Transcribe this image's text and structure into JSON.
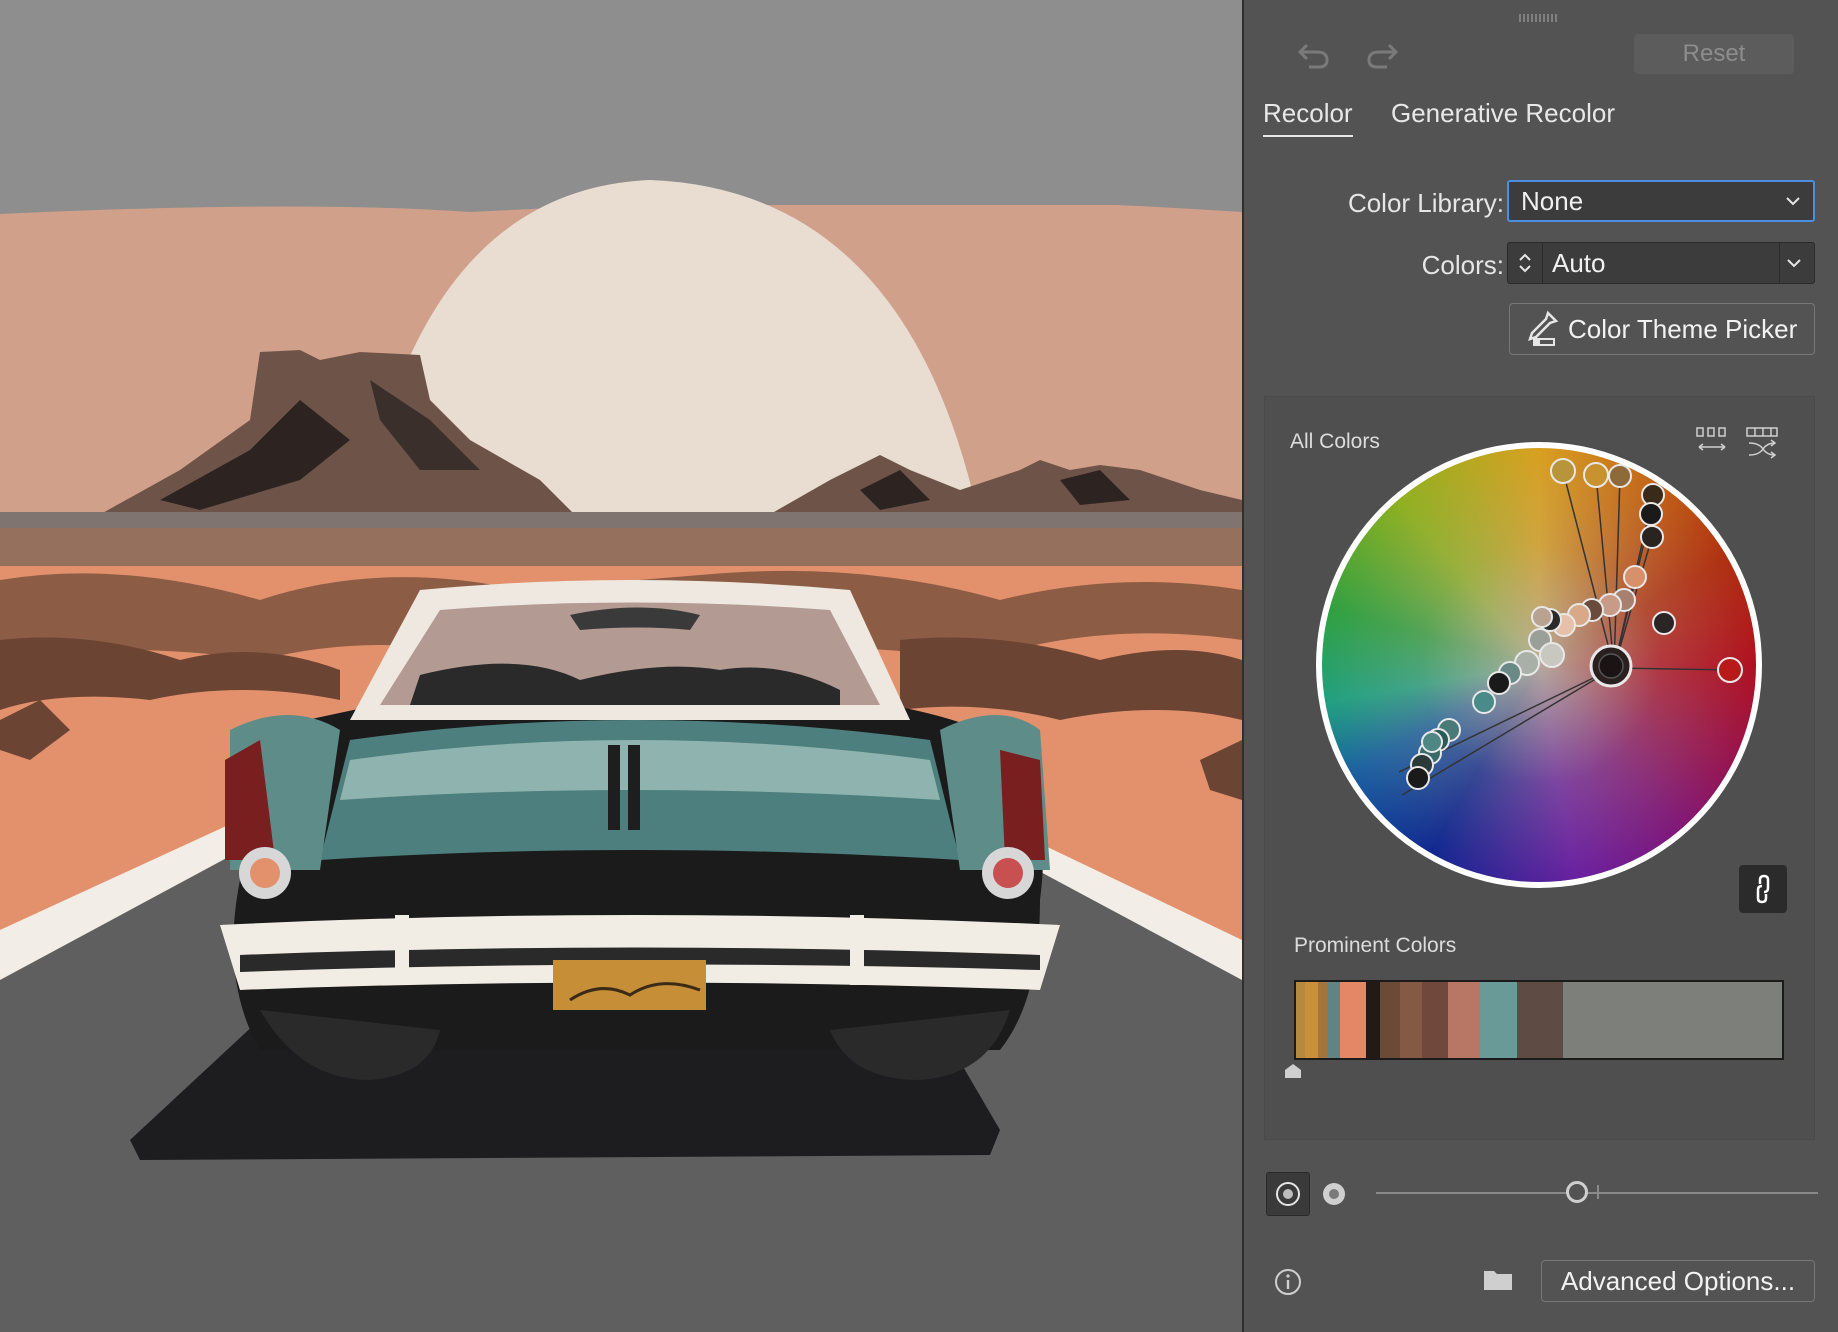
{
  "artwork": {
    "description_icon": "illustration-vintage-car-desert"
  },
  "history": {
    "undo_icon": "undo-icon",
    "redo_icon": "redo-icon"
  },
  "reset_label": "Reset",
  "tabs": [
    {
      "label": "Recolor",
      "active": true
    },
    {
      "label": "Generative Recolor",
      "active": false
    }
  ],
  "color_library": {
    "label": "Color Library:",
    "value": "None"
  },
  "colors": {
    "label": "Colors:",
    "value": "Auto"
  },
  "color_theme_picker_label": "Color Theme Picker",
  "all_colors": {
    "title": "All Colors"
  },
  "prominent_colors": {
    "title": "Prominent Colors",
    "swatches": [
      {
        "color": "#b58a3e",
        "share": 1
      },
      {
        "color": "#c9903a",
        "share": 1.5
      },
      {
        "color": "#a6733a",
        "share": 1
      },
      {
        "color": "#5f8483",
        "share": 1.5
      },
      {
        "color": "#e38767",
        "share": 3
      },
      {
        "color": "#231a16",
        "share": 1.6
      },
      {
        "color": "#6b4a36",
        "share": 2.3
      },
      {
        "color": "#855a44",
        "share": 2.5
      },
      {
        "color": "#71493c",
        "share": 3
      },
      {
        "color": "#b87665",
        "share": 3.6
      },
      {
        "color": "#6a9a98",
        "share": 4.3
      },
      {
        "color": "#5e4b43",
        "share": 5.2
      },
      {
        "color": "#7d7f7b",
        "share": 25
      }
    ]
  },
  "advanced_options_label": "Advanced Options..."
}
